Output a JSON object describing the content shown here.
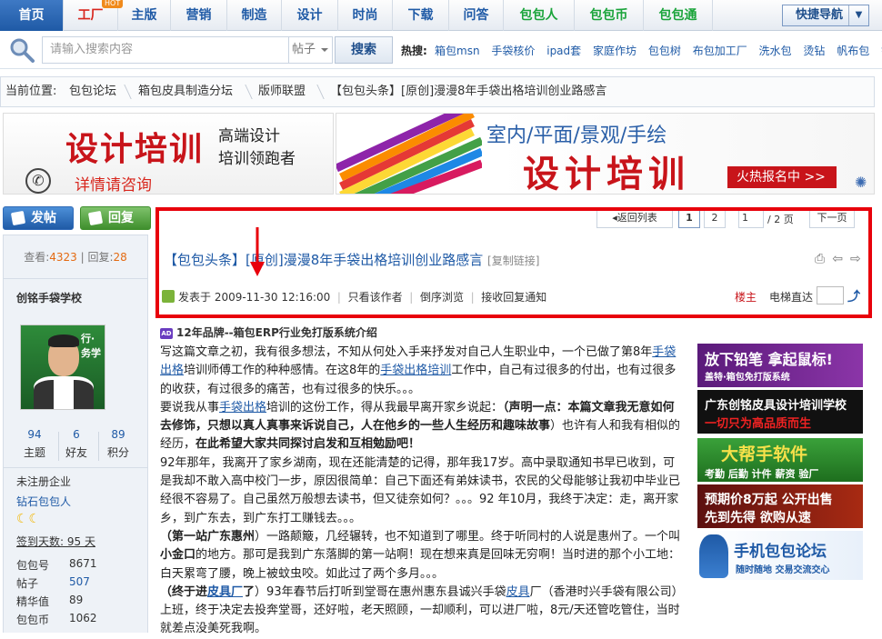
{
  "nav": {
    "items": [
      "首页",
      "工厂",
      "主版",
      "营销",
      "制造",
      "设计",
      "时尚",
      "下载",
      "问答",
      "包包人",
      "包包币",
      "包包通"
    ],
    "hot_badge": "HOT",
    "quick_nav": "快捷导航"
  },
  "search": {
    "placeholder": "请输入搜索内容",
    "type": "帖子",
    "button": "搜索",
    "hot_label": "热搜:",
    "hot_links": [
      "箱包msn",
      "手袋核价",
      "ipad套",
      "家庭作坊",
      "包包树",
      "布包加工厂",
      "洗水包",
      "烫钻",
      "帆布包",
      "钱包"
    ]
  },
  "breadcrumb": {
    "prefix": "当前位置:",
    "items": [
      "包包论坛",
      "箱包皮具制造分坛",
      "版师联盟",
      "【包包头条】[原创]漫漫8年手袋出格培训创业路感言"
    ]
  },
  "banner_left": {
    "headline": "设计培训",
    "line1": "高端设计",
    "line2": "培训领跑者",
    "cta": "详情请咨询"
  },
  "banner_right": {
    "line1": "室内/平面/景观/手绘",
    "headline": "设计培训",
    "cta": "火热报名中 >>"
  },
  "actions": {
    "post": "发帖",
    "reply": "回复"
  },
  "pager": {
    "back": "返回列表",
    "p1": "1",
    "p2": "2",
    "input": "1",
    "total": "/ 2 页",
    "next": "下一页"
  },
  "thread": {
    "title": "【包包头条】[原创]漫漫8年手袋出格培训创业路感言",
    "copy_link": "[复制链接]",
    "posted": "发表于 2009-11-30 12:16:00",
    "only_author": "只看该作者",
    "reverse": "倒序浏览",
    "notify": "接收回复通知",
    "owner": "楼主",
    "jump": "电梯直达"
  },
  "sidebar": {
    "views_label": "查看:",
    "views": "4323",
    "replies_label": "回复:",
    "replies": "28",
    "author": "创铭手袋学校",
    "avatar_caption": "行·务学",
    "stats": [
      {
        "value": "94",
        "label": "主题"
      },
      {
        "value": "6",
        "label": "好友"
      },
      {
        "value": "89",
        "label": "积分"
      }
    ],
    "group": "未注册企业",
    "rank": "钻石包包人",
    "signin": "签到天数: 95 天",
    "kv": [
      {
        "k": "包包号",
        "v": "8671"
      },
      {
        "k": "帖子",
        "v": "507"
      },
      {
        "k": "精华值",
        "v": "89"
      },
      {
        "k": "包包币",
        "v": "1062"
      }
    ]
  },
  "post": {
    "ad_badge": "AD",
    "ad_title": "12年品牌--箱包ERP行业免打版系统介绍",
    "p1a": "写这篇文章之初，我有很多想法，不知从何处入手来抒发对自己人生职业中，一个已做了第8年",
    "p1link": "手袋出格",
    "p1b": "培训师傅工作的种种感情。在这8年的",
    "p1link2": "手袋出格培训",
    "p1c": "工作中，自己有过很多的付出，也有过很多的收获，有过很多的痛苦，也有过很多的快乐。。。",
    "p2a": "要说我从事",
    "p2link": "手袋出格",
    "p2b": "培训的这份工作，得从我最早离开家乡说起：",
    "p2bold": "（声明一点：本篇文章我无意如何去修饰，只想以真人真事来诉说自己，人在他乡的一些人生经历和趣味故事",
    "p2c": "）也许有人和我有相似的经历，",
    "p2bold2": "在此希望大家共同探讨启发和互相勉励吧！",
    "p3": "92年那年，我离开了家乡湖南，现在还能清楚的记得，那年我17岁。高中录取通知书早已收到，可是我却不敢入高中校门一步，原因很简单：自己下面还有弟妹读书，农民的父母能够让我初中毕业已经很不容易了。自己虽然万般想去读书，但又徒奈如何？。。。92 年10月，我终于决定：走，离开家乡，到广东去，到广东打工赚钱去。。。",
    "p4bold": "（第一站广东惠州",
    "p4a": "）一路颠簸，几经辗转，也不知道到了哪里。终于听同村的人说是惠州了。一个叫",
    "p4bold2": "小金口",
    "p4b": "的地方。那可是我到广东落脚的第一站啊！现在想来真是回味无穷啊！当时进的那个小工地：白天累弯了腰，晚上被蚊虫咬。如此过了两个多月。。。",
    "p5bold": "（终于进",
    "p5link": "皮具厂",
    "p5bold2": "了",
    "p5a": "）93年春节后打听到堂哥在惠州惠东县诚兴手袋",
    "p5link2": "皮具",
    "p5b": "厂（香港时兴手袋有限公司）上班，终于决定去投奔堂哥，还好啦，老天照顾，一却顺利，可以进厂啦，8元/天还管吃管住，当时就差点没美死我啊。"
  },
  "ads": [
    {
      "a": "放下铅笔 拿起鼠标!",
      "b": "盖特·箱包免打版系统"
    },
    {
      "a": "广东创铭皮具设计培训学校",
      "b": "一切只为高品质而生"
    },
    {
      "a": "大帮手软件",
      "b": "考勤 后勤 计件 薪资 验厂"
    },
    {
      "a": "预期价8万起 公开出售",
      "b": "先到先得 欲购从速"
    },
    {
      "a": "手机包包论坛",
      "b": "随时随地 交易交流交心"
    }
  ],
  "colors": {
    "nav_blue": "#1f5aa6",
    "highlight_red": "#e8000b",
    "accent_orange": "#e46a12"
  }
}
